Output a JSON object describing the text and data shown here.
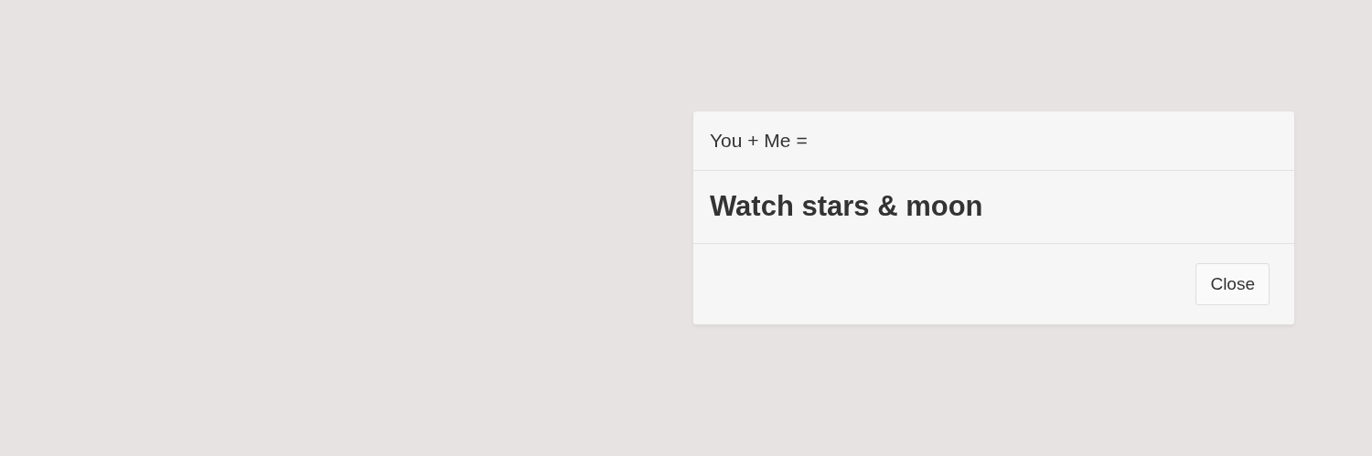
{
  "dialog": {
    "title": "You + Me =",
    "message": "Watch stars & moon",
    "buttons": [
      "Close"
    ]
  }
}
